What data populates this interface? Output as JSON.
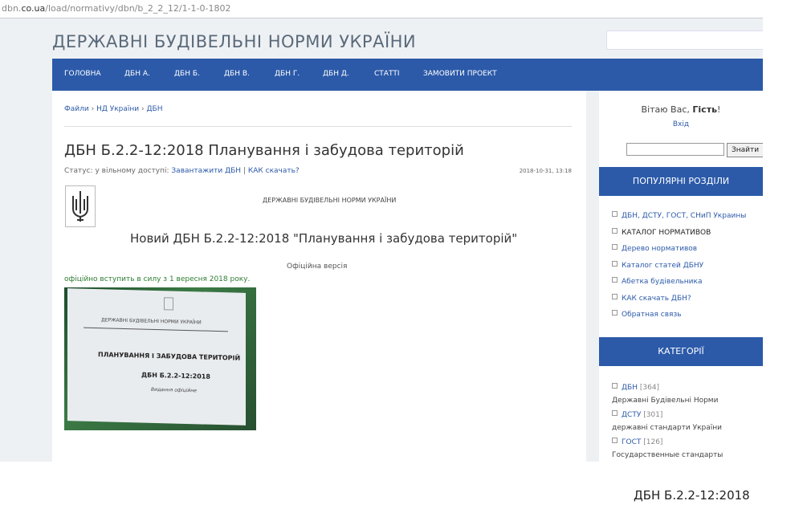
{
  "browser": {
    "url_prefix": "dbn.",
    "url_host": "co.ua",
    "url_path": "/load/normativy/dbn/b_2_2_12/1-1-0-1802"
  },
  "site": {
    "title": "ДЕРЖАВНІ БУДІВЕЛЬНІ НОРМИ УКРАЇНИ"
  },
  "nav": [
    "ГОЛОВНА",
    "ДБН А.",
    "ДБН Б.",
    "ДБН В.",
    "ДБН Г.",
    "ДБН Д.",
    "СТАТТІ",
    "ЗАМОВИТИ ПРОЕКТ"
  ],
  "breadcrumb": {
    "items": [
      "Файли",
      "НД України",
      "ДБН"
    ],
    "sep": "›"
  },
  "article": {
    "title": "ДБН Б.2.2-12:2018 Планування і забудова територій",
    "status_label": "Статус: у вільному доступі:",
    "download_link": "Завантажити ДБН",
    "how_link": "КАК скачать?",
    "link_sep": "|",
    "date": "2018-10-31, 13:18",
    "doc_header": "ДЕРЖАВНІ БУДІВЕЛЬНІ НОРМИ УКРАЇНИ",
    "doc_title": "Новий ДБН Б.2.2-12:2018 \"Планування і забудова територій\"",
    "official": "Офіційна версія",
    "effective": "офіційно вступить в силу з 1 вересня 2018 року."
  },
  "photo": {
    "header": "ДЕРЖАВНІ БУДІВЕЛЬНІ НОРМИ УКРАЇНИ",
    "title": "ПЛАНУВАННЯ І ЗАБУДОВА ТЕРИТОРІЙ",
    "code": "ДБН Б.2.2-12:2018",
    "edition": "Видання офіційне"
  },
  "sidebar": {
    "greeting": "Вітаю Вас,",
    "guest": "Гість",
    "greeting_end": "!",
    "login": "Вхід",
    "search_button": "Знайти",
    "popular_title": "ПОПУЛЯРНІ РОЗДІЛИ",
    "popular": [
      "ДБН, ДСТУ, ГОСТ, СНиП Украины",
      "КАТАЛОГ НОРМАТИВОВ",
      "Дерево нормативов",
      "Каталог статей ДБНУ",
      "Абетка будівельника",
      "КАК скачать ДБН?",
      "Обратная связь"
    ],
    "categories_title": "КАТЕГОРІЇ",
    "categories": [
      {
        "name": "ДБН",
        "count": "[364]",
        "desc": "Державні Будівельні Норми"
      },
      {
        "name": "ДСТУ",
        "count": "[301]",
        "desc": "державні стандарти України"
      },
      {
        "name": "ГОСТ",
        "count": "[126]",
        "desc": "Государственные стандарты"
      }
    ]
  },
  "caption": "ДБН Б.2.2-12:2018"
}
